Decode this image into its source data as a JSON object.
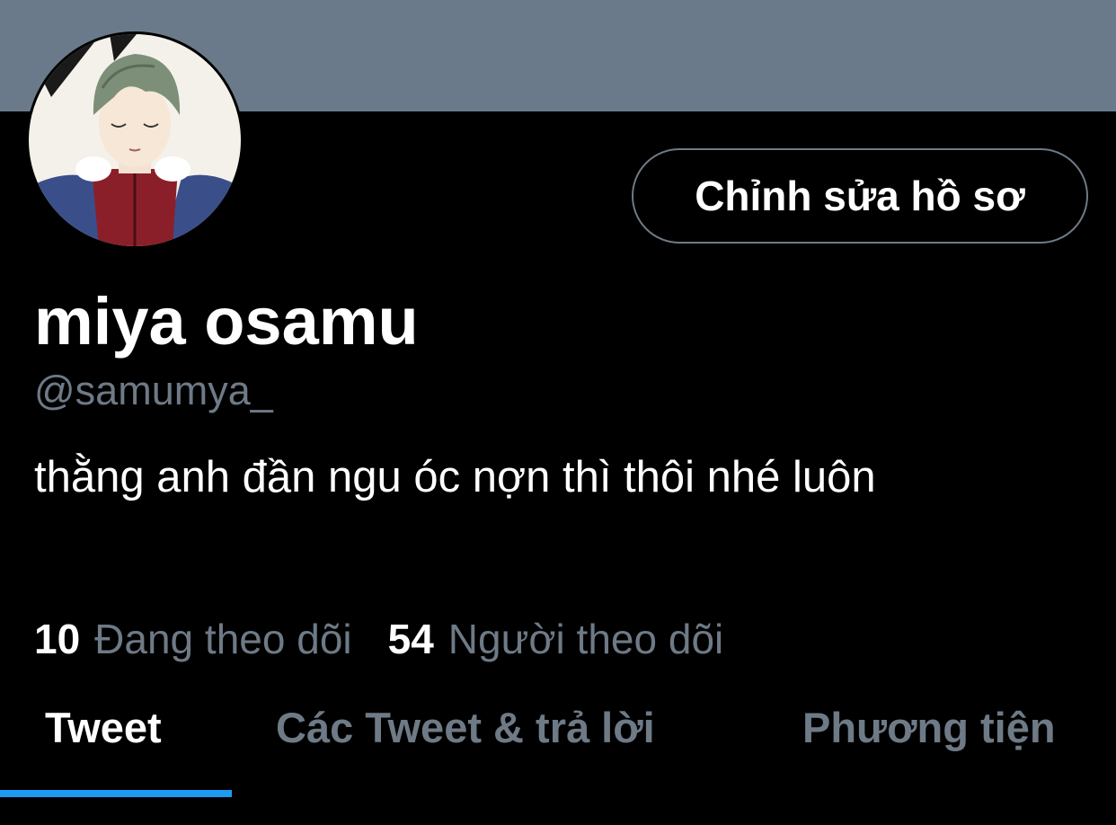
{
  "profile": {
    "display_name": "miya osamu",
    "handle": "@samumya_",
    "bio": "thằng anh đần ngu óc nợn thì thôi nhé luôn",
    "edit_button_label": "Chỉnh sửa hồ sơ"
  },
  "stats": {
    "following_count": "10",
    "following_label": "Đang theo dõi",
    "followers_count": "54",
    "followers_label": "Người theo dõi"
  },
  "tabs": [
    {
      "label": "Tweet",
      "active": true
    },
    {
      "label": "Các Tweet & trả lời",
      "active": false
    },
    {
      "label": "Phương tiện",
      "active": false
    }
  ],
  "colors": {
    "background": "#000000",
    "banner": "#6b7a8a",
    "secondary_text": "#6e7a86",
    "accent": "#1d9bf0"
  }
}
